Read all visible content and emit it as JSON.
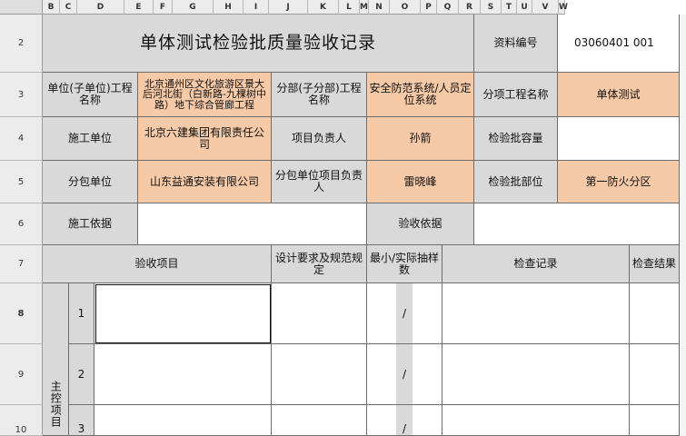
{
  "columns": [
    "B",
    "C",
    "D",
    "E",
    "F",
    "G",
    "H",
    "I",
    "J",
    "K",
    "L",
    "M",
    "N",
    "O",
    "P",
    "Q",
    "R",
    "S",
    "T",
    "U",
    "V",
    "W"
  ],
  "rows": [
    "2",
    "3",
    "4",
    "5",
    "6",
    "7",
    "8",
    "9",
    "10"
  ],
  "selected_row": "8",
  "title": "单体测试检验批质量验收记录",
  "doc_id_label": "资料编号",
  "doc_id_value": "03060401 001",
  "r3": {
    "unit_label": "单位(子单位)工程名称",
    "unit_value": "北京通州区文化旅游区景大后河北街（白新路-九棵树中路）地下综合管廊工程",
    "sub_label": "分部(子分部)工程名称",
    "sub_value": "安全防范系统/人员定位系统",
    "item_label": "分项工程名称",
    "item_value": "单体测试"
  },
  "r4": {
    "constructor_label": "施工单位",
    "constructor_value": "北京六建集团有限责任公司",
    "pm_label": "项目负责人",
    "pm_value": "孙箭",
    "capacity_label": "检验批容量",
    "capacity_value": ""
  },
  "r5": {
    "subcontractor_label": "分包单位",
    "subcontractor_value": "山东益通安装有限公司",
    "sub_pm_label": "分包单位项目负责人",
    "sub_pm_value": "雷晓峰",
    "location_label": "检验批部位",
    "location_value": "第一防火分区"
  },
  "r6": {
    "basis_label": "施工依据",
    "acceptance_basis_label": "验收依据"
  },
  "r7": {
    "item_header": "验收项目",
    "design_header": "设计要求及规范规定",
    "sample_header": "最小/实际抽样数",
    "record_header": "检查记录",
    "result_header": "检查结果"
  },
  "main_items_label": "主控项目",
  "items": [
    {
      "no": "1",
      "sample": "/"
    },
    {
      "no": "2",
      "sample": "/"
    },
    {
      "no": "3",
      "sample": "/"
    }
  ]
}
